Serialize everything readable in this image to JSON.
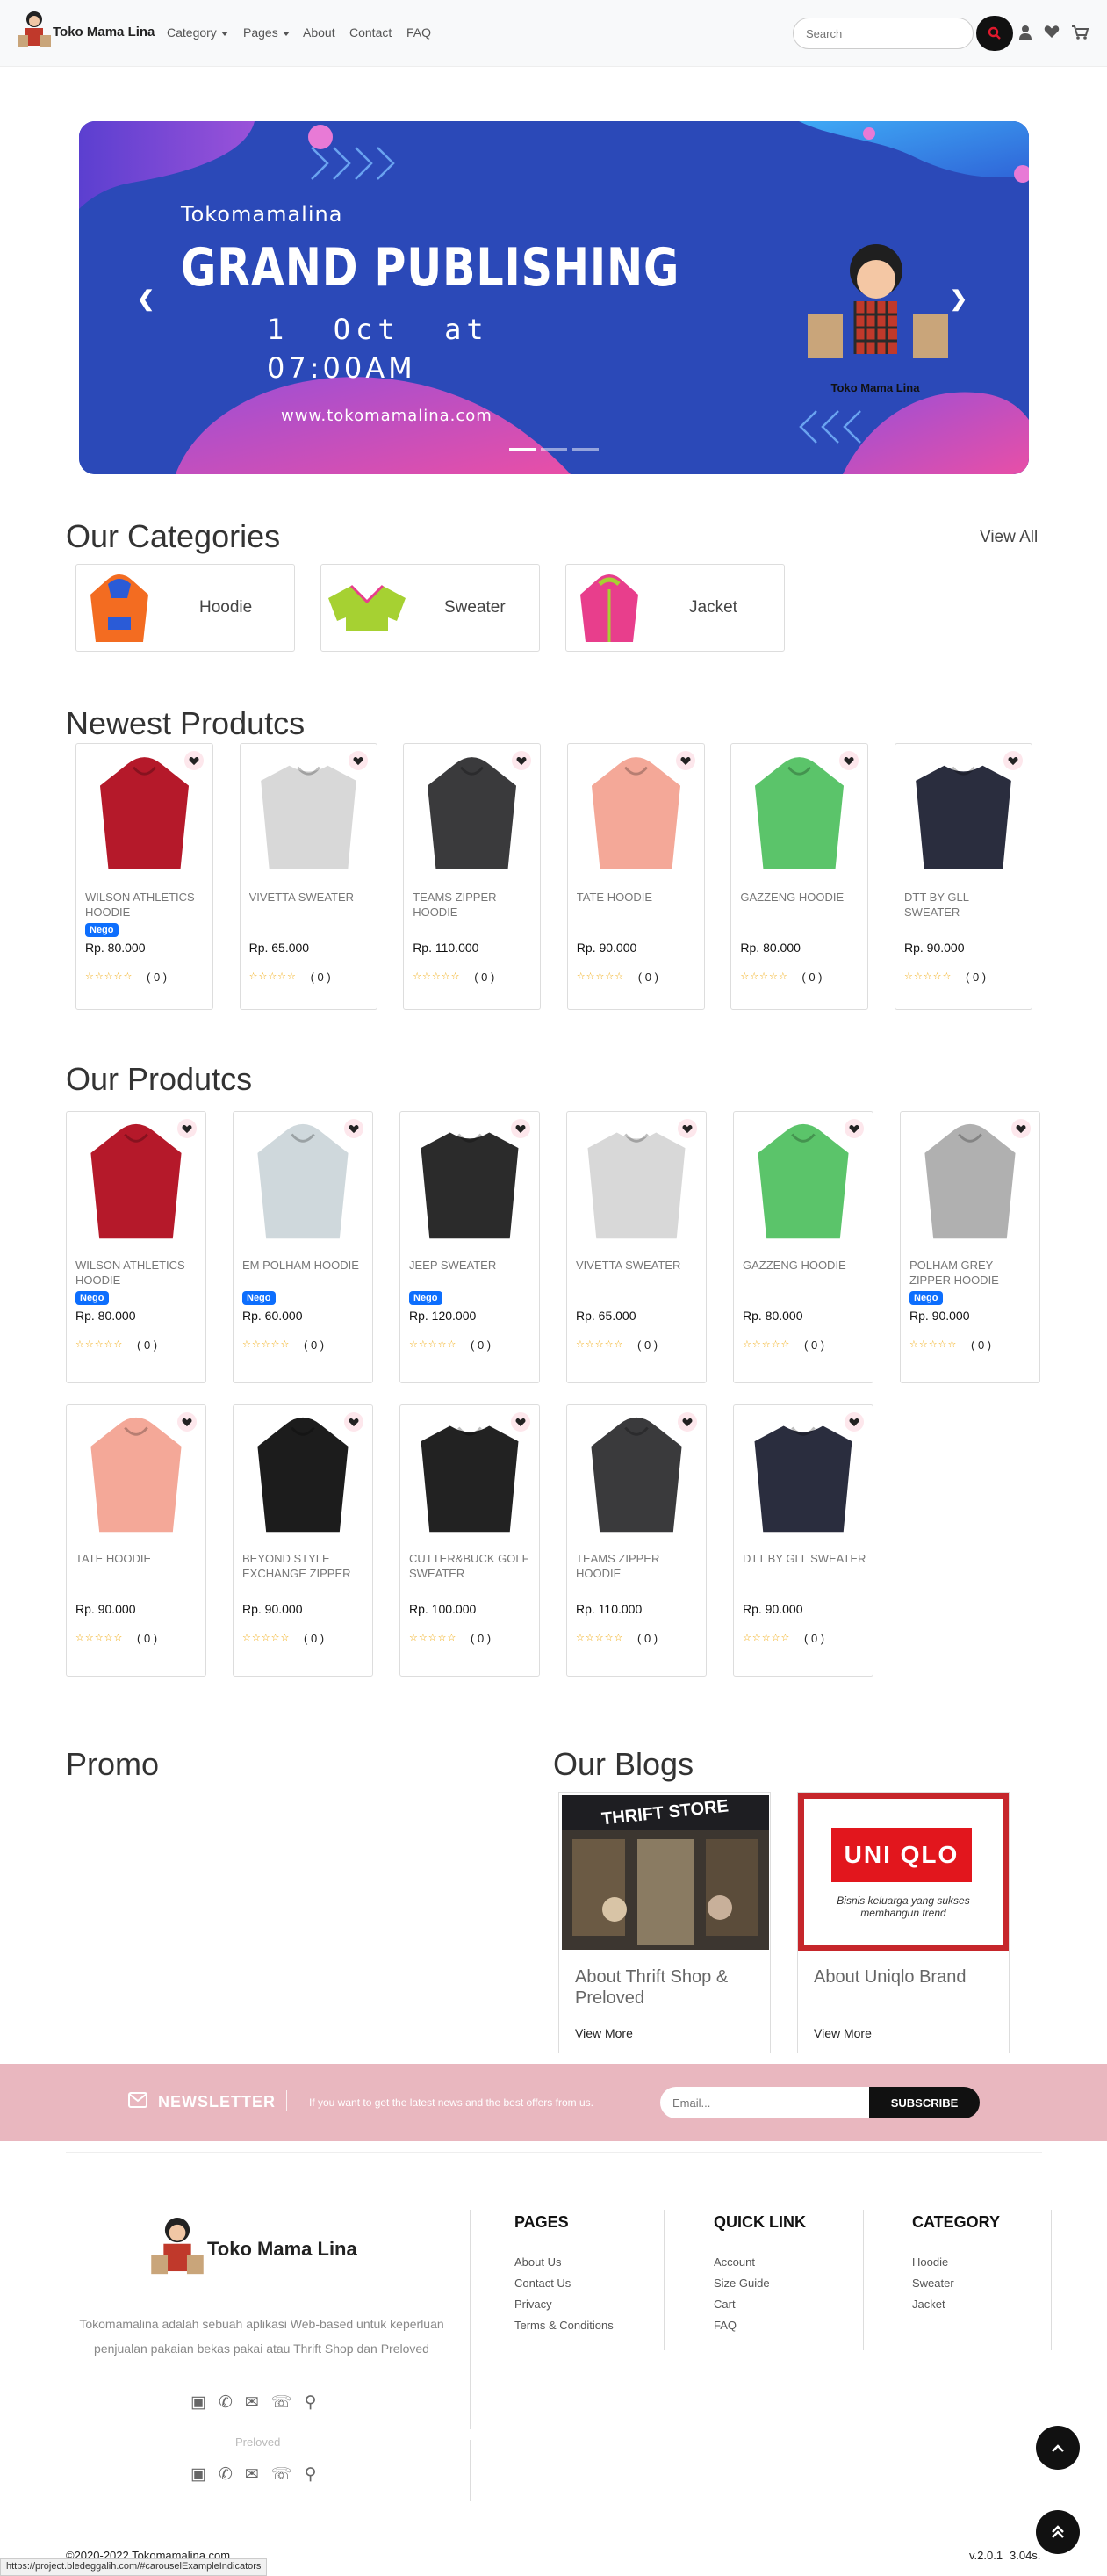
{
  "nav": {
    "brand": "Toko Mama Lina",
    "links": [
      "Category",
      "Pages",
      "About",
      "Contact",
      "FAQ"
    ],
    "search_placeholder": "Search"
  },
  "hero": {
    "line1": "Tokomamalina",
    "line2": "GRAND PUBLISHING",
    "line3": "1  Oct  at",
    "line4": "07:00AM",
    "url": "www.tokomamalina.com",
    "logo_text": "Toko Mama Lina"
  },
  "categories": {
    "title": "Our Categories",
    "view_all": "View All",
    "items": [
      {
        "label": "Hoodie",
        "color": "#f36c21"
      },
      {
        "label": "Sweater",
        "color": "#a6d132"
      },
      {
        "label": "Jacket",
        "color": "#e83e8c"
      }
    ]
  },
  "newest": {
    "title": "Newest Produtcs",
    "items": [
      {
        "name": "WILSON ATHLETICS HOODIE",
        "badge": "Nego",
        "price": "Rp. 80.000",
        "count": "( 0 )",
        "color": "#b5192a"
      },
      {
        "name": "VIVETTA SWEATER",
        "badge": "",
        "price": "Rp. 65.000",
        "count": "( 0 )",
        "color": "#d8d8d8"
      },
      {
        "name": "TEAMS ZIPPER HOODIE",
        "badge": "",
        "price": "Rp. 110.000",
        "count": "( 0 )",
        "color": "#3a3a3c"
      },
      {
        "name": "TATE HOODIE",
        "badge": "",
        "price": "Rp. 90.000",
        "count": "( 0 )",
        "color": "#f4a898"
      },
      {
        "name": "Gazzeng Hoodie",
        "badge": "",
        "price": "Rp. 80.000",
        "count": "( 0 )",
        "color": "#5bc46a"
      },
      {
        "name": "DTT BY GLL SWEATER",
        "badge": "",
        "price": "Rp. 90.000",
        "count": "( 0 )",
        "color": "#2a2d3e"
      }
    ]
  },
  "products": {
    "title": "Our Produtcs",
    "items": [
      {
        "name": "WILSON ATHLETICS HOODIE",
        "badge": "Nego",
        "price": "Rp. 80.000",
        "count": "( 0 )",
        "color": "#b5192a"
      },
      {
        "name": "EM POLHAM HOODIE",
        "badge": "Nego",
        "price": "Rp. 60.000",
        "count": "( 0 )",
        "color": "#cfd8dc"
      },
      {
        "name": "JEEP SWEATER",
        "badge": "Nego",
        "price": "Rp. 120.000",
        "count": "( 0 )",
        "color": "#2b2b2b"
      },
      {
        "name": "VIVETTA SWEATER",
        "badge": "",
        "price": "Rp. 65.000",
        "count": "( 0 )",
        "color": "#d8d8d8"
      },
      {
        "name": "Gazzeng Hoodie",
        "badge": "",
        "price": "Rp. 80.000",
        "count": "( 0 )",
        "color": "#5bc46a"
      },
      {
        "name": "POLHAM GREY ZIPPER HOODIE",
        "badge": "Nego",
        "price": "Rp. 90.000",
        "count": "( 0 )",
        "color": "#b0b0b0"
      },
      {
        "name": "TATE HOODIE",
        "badge": "",
        "price": "Rp. 90.000",
        "count": "( 0 )",
        "color": "#f4a898"
      },
      {
        "name": "BEYOND STYLE EXCHANGE ZIPPER HOODIE",
        "badge": "",
        "price": "Rp. 90.000",
        "count": "( 0 )",
        "color": "#1c1c1c"
      },
      {
        "name": "CUTTER&BUCK GOLF SWEATER",
        "badge": "",
        "price": "Rp. 100.000",
        "count": "( 0 )",
        "color": "#222222"
      },
      {
        "name": "TEAMS ZIPPER HOODIE",
        "badge": "",
        "price": "Rp. 110.000",
        "count": "( 0 )",
        "color": "#3a3a3c"
      },
      {
        "name": "DTT BY GLL SWEATER",
        "badge": "",
        "price": "Rp. 90.000",
        "count": "( 0 )",
        "color": "#2a2d3e"
      }
    ]
  },
  "promo": {
    "title": "Promo"
  },
  "blogs": {
    "title": "Our Blogs",
    "items": [
      {
        "title": "About Thrift Shop & Preloved",
        "more": "View More",
        "image_text": "THRIFT STORE"
      },
      {
        "title": "About Uniqlo Brand",
        "more": "View More",
        "image_text": "UNI QLO",
        "caption": "Bisnis keluarga yang sukses membangun trend"
      }
    ]
  },
  "newsletter": {
    "label": "NEWSLETTER",
    "text": "If you want to get the latest news and the best offers from us.",
    "placeholder": "Email...",
    "button": "SUBSCRIBE"
  },
  "footer": {
    "brand": "Toko Mama Lina",
    "description": "Tokomamalina adalah sebuah aplikasi Web-based untuk keperluan penjualan pakaian bekas pakai atau Thrift Shop dan Preloved",
    "ghost_text": "Preloved",
    "pages_title": "PAGES",
    "pages": [
      "About Us",
      "Contact Us",
      "Privacy",
      "Terms & Conditions"
    ],
    "quick_title": "QUICK LINK",
    "quick": [
      "Account",
      "Size Guide",
      "Cart",
      "FAQ"
    ],
    "category_title": "CATEGORY",
    "category": [
      "Hoodie",
      "Sweater",
      "Jacket"
    ],
    "copyright": "©2020-2022 Tokomamalina.com",
    "version": "v.2.0.1",
    "timing": "3.04s.",
    "status_url": "https://project.bledeggalih.com/#carouselExampleIndicators"
  }
}
